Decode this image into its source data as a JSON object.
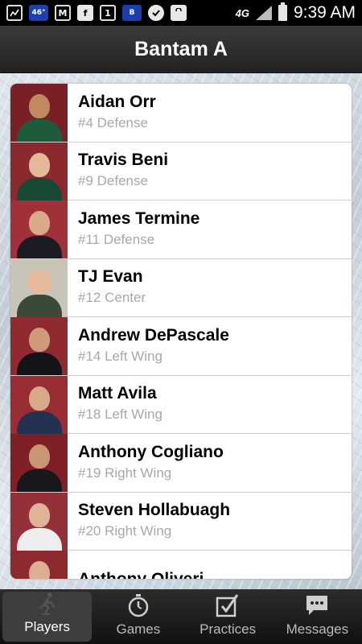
{
  "status_bar": {
    "notifications": [
      {
        "icon": "gallery-icon",
        "text": ""
      },
      {
        "icon": "weather-icon",
        "text": "46°"
      },
      {
        "icon": "gmail-icon",
        "text": "M"
      },
      {
        "icon": "facebook-icon",
        "text": "f"
      },
      {
        "icon": "calendar-icon",
        "text": "1"
      },
      {
        "icon": "app-badge-icon",
        "text": "B"
      },
      {
        "icon": "check-icon",
        "text": ""
      },
      {
        "icon": "shopping-bag-icon",
        "text": ""
      }
    ],
    "network": "4G",
    "time": "9:39 AM"
  },
  "header": {
    "title": "Bantam A"
  },
  "players": [
    {
      "name": "Aidan Orr",
      "position": "#4 Defense"
    },
    {
      "name": "Travis Beni",
      "position": "#9 Defense"
    },
    {
      "name": "James Termine",
      "position": "#11 Defense"
    },
    {
      "name": "TJ Evan",
      "position": "#12 Center"
    },
    {
      "name": "Andrew DePascale",
      "position": "#14 Left Wing"
    },
    {
      "name": "Matt Avila",
      "position": "#18 Left Wing"
    },
    {
      "name": "Anthony Cogliano",
      "position": "#19 Right Wing"
    },
    {
      "name": "Steven Hollabuagh",
      "position": "#20 Right Wing"
    },
    {
      "name": "Anthony Oliveri",
      "position": ""
    }
  ],
  "tabs": [
    {
      "label": "Players",
      "icon": "skater-icon",
      "active": true
    },
    {
      "label": "Games",
      "icon": "stopwatch-icon",
      "active": false
    },
    {
      "label": "Practices",
      "icon": "checklist-icon",
      "active": false
    },
    {
      "label": "Messages",
      "icon": "chat-bubble-icon",
      "active": false
    }
  ],
  "colors": {
    "title_bar": "#2f2f2f",
    "tab_bar": "#1e1e1e",
    "position_text": "#a8a8a8"
  }
}
